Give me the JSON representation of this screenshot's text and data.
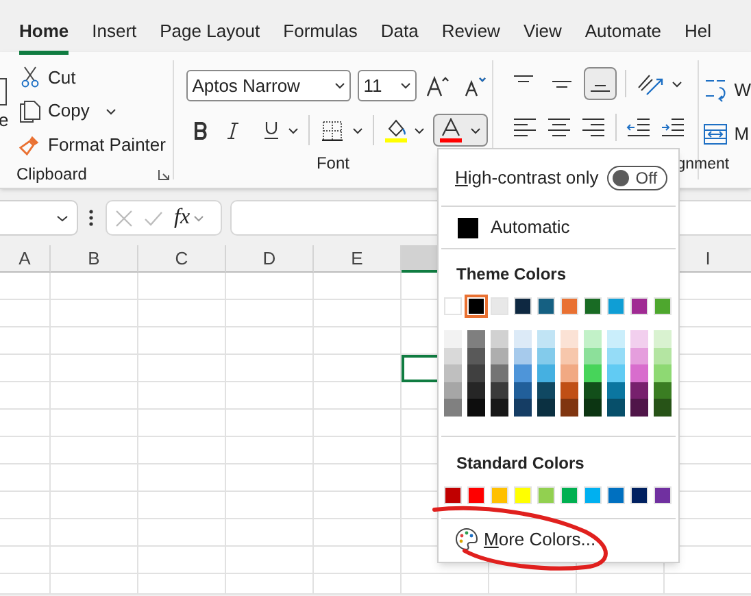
{
  "tabs": [
    {
      "label": "Home",
      "selected": true
    },
    {
      "label": "Insert",
      "selected": false
    },
    {
      "label": "Page Layout",
      "selected": false
    },
    {
      "label": "Formulas",
      "selected": false
    },
    {
      "label": "Data",
      "selected": false
    },
    {
      "label": "Review",
      "selected": false
    },
    {
      "label": "View",
      "selected": false
    },
    {
      "label": "Automate",
      "selected": false
    },
    {
      "label": "Hel",
      "selected": false
    }
  ],
  "clipboard": {
    "paste_label": "e",
    "items": [
      {
        "label": "Cut",
        "dropdown": false
      },
      {
        "label": "Copy",
        "dropdown": true
      },
      {
        "label": "Format Painter",
        "dropdown": false
      }
    ],
    "group_label": "Clipboard"
  },
  "font": {
    "font_name": "Aptos Narrow",
    "font_size": "11",
    "group_label": "Font",
    "font_color_open": true
  },
  "alignment": {
    "vertical_align": [
      {
        "selected": false
      },
      {
        "selected": false
      },
      {
        "selected": true
      }
    ],
    "group_label": "gnment",
    "wrap_label": "W",
    "merge_label": "M"
  },
  "formula_bar": {
    "function_label": "fx"
  },
  "sheet": {
    "columns_left": [
      {
        "label": "A",
        "selected": false
      },
      {
        "label": "B",
        "selected": false
      },
      {
        "label": "C",
        "selected": false
      },
      {
        "label": "D",
        "selected": false
      },
      {
        "label": "E",
        "selected": false
      },
      {
        "selected": true
      }
    ],
    "columns_right": [
      {
        "label": "I",
        "selected": false
      }
    ],
    "rows": [
      {
        "selected": false
      },
      {
        "selected": false
      },
      {
        "selected": false
      },
      {
        "selected": true
      },
      {
        "selected": false
      },
      {
        "selected": false
      },
      {
        "selected": false
      },
      {
        "selected": false
      },
      {
        "selected": false
      },
      {
        "selected": false
      },
      {
        "selected": false
      },
      {
        "selected": false
      }
    ]
  },
  "color_menu": {
    "high_contrast": {
      "label": "High-contrast only",
      "on": false,
      "state_label": "Off"
    },
    "automatic": {
      "label": "Automatic",
      "color": "#000000"
    },
    "theme_title": "Theme Colors",
    "theme_colors": [
      {
        "color": "#ffffff",
        "selected": false
      },
      {
        "color": "#000000",
        "selected": true
      },
      {
        "color": "#e8e8e8",
        "selected": false
      },
      {
        "color": "#0e2841",
        "selected": false
      },
      {
        "color": "#156082",
        "selected": false
      },
      {
        "color": "#e97132",
        "selected": false
      },
      {
        "color": "#196b24",
        "selected": false
      },
      {
        "color": "#0f9ed5",
        "selected": false
      },
      {
        "color": "#a02b93",
        "selected": false
      },
      {
        "color": "#4ea72e",
        "selected": false
      }
    ],
    "theme_shades": [
      [
        {
          "color": "#f2f2f2"
        },
        {
          "color": "#7f7f7f"
        },
        {
          "color": "#d1d1d1"
        },
        {
          "color": "#dceaf7"
        },
        {
          "color": "#c1e4f5"
        },
        {
          "color": "#fbe2d5"
        },
        {
          "color": "#c2f1c8"
        },
        {
          "color": "#caeefb"
        },
        {
          "color": "#f2cfee"
        },
        {
          "color": "#d9f2d0"
        }
      ],
      [
        {
          "color": "#d9d9d9"
        },
        {
          "color": "#595959"
        },
        {
          "color": "#aeaeae"
        },
        {
          "color": "#a6caec"
        },
        {
          "color": "#83cbeb"
        },
        {
          "color": "#f7c7ac"
        },
        {
          "color": "#8ce09a"
        },
        {
          "color": "#95dcf7"
        },
        {
          "color": "#e59edd"
        },
        {
          "color": "#b4e5a2"
        }
      ],
      [
        {
          "color": "#bfbfbf"
        },
        {
          "color": "#404040"
        },
        {
          "color": "#747474"
        },
        {
          "color": "#4e95d9"
        },
        {
          "color": "#45b0e1"
        },
        {
          "color": "#f1a983"
        },
        {
          "color": "#47d45a"
        },
        {
          "color": "#61cbf3"
        },
        {
          "color": "#d86dcd"
        },
        {
          "color": "#8ed973"
        }
      ],
      [
        {
          "color": "#a6a6a6"
        },
        {
          "color": "#262626"
        },
        {
          "color": "#3a3a3a"
        },
        {
          "color": "#215f9a"
        },
        {
          "color": "#104862"
        },
        {
          "color": "#c04f15"
        },
        {
          "color": "#124f1a"
        },
        {
          "color": "#0b76a0"
        },
        {
          "color": "#77206d"
        },
        {
          "color": "#3a7d22"
        }
      ],
      [
        {
          "color": "#808080"
        },
        {
          "color": "#0d0d0d"
        },
        {
          "color": "#171717"
        },
        {
          "color": "#153d64"
        },
        {
          "color": "#0b3041"
        },
        {
          "color": "#803510"
        },
        {
          "color": "#0c3512"
        },
        {
          "color": "#074f6a"
        },
        {
          "color": "#501549"
        },
        {
          "color": "#275317"
        }
      ]
    ],
    "standard_title": "Standard Colors",
    "standard_colors": [
      {
        "color": "#c00000"
      },
      {
        "color": "#ff0000"
      },
      {
        "color": "#ffc000"
      },
      {
        "color": "#ffff00"
      },
      {
        "color": "#92d050"
      },
      {
        "color": "#00b050"
      },
      {
        "color": "#00b0f0"
      },
      {
        "color": "#0070c0"
      },
      {
        "color": "#002060"
      },
      {
        "color": "#7030a0"
      }
    ],
    "more_colors": "More Colors..."
  }
}
